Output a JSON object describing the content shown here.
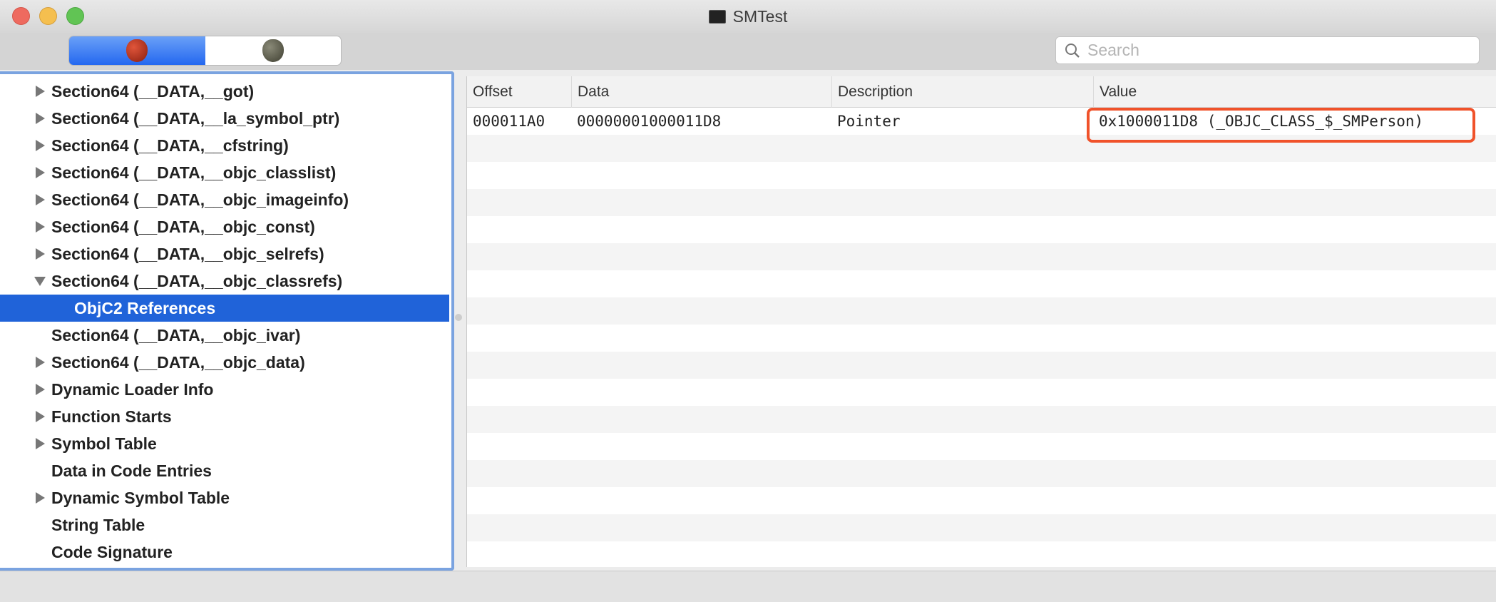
{
  "window": {
    "title": "SMTest"
  },
  "toolbar": {
    "segments": [
      {
        "icon": "apple-red-icon",
        "selected": true
      },
      {
        "icon": "apple-gray-icon",
        "selected": false
      }
    ],
    "search_placeholder": "Search"
  },
  "sidebar": {
    "items": [
      {
        "label": "Section64 (__DATA,__got)",
        "arrow": "right"
      },
      {
        "label": "Section64 (__DATA,__la_symbol_ptr)",
        "arrow": "right"
      },
      {
        "label": "Section64 (__DATA,__cfstring)",
        "arrow": "right"
      },
      {
        "label": "Section64 (__DATA,__objc_classlist)",
        "arrow": "right"
      },
      {
        "label": "Section64 (__DATA,__objc_imageinfo)",
        "arrow": "right"
      },
      {
        "label": "Section64 (__DATA,__objc_const)",
        "arrow": "right"
      },
      {
        "label": "Section64 (__DATA,__objc_selrefs)",
        "arrow": "right"
      },
      {
        "label": "Section64 (__DATA,__objc_classrefs)",
        "arrow": "down"
      },
      {
        "label": "ObjC2 References",
        "arrow": "none",
        "child": true,
        "selected": true
      },
      {
        "label": "Section64 (__DATA,__objc_ivar)",
        "arrow": "none"
      },
      {
        "label": "Section64 (__DATA,__objc_data)",
        "arrow": "right"
      },
      {
        "label": "Dynamic Loader Info",
        "arrow": "right"
      },
      {
        "label": "Function Starts",
        "arrow": "right"
      },
      {
        "label": "Symbol Table",
        "arrow": "right"
      },
      {
        "label": "Data in Code Entries",
        "arrow": "none"
      },
      {
        "label": "Dynamic Symbol Table",
        "arrow": "right"
      },
      {
        "label": "String Table",
        "arrow": "none"
      },
      {
        "label": "Code Signature",
        "arrow": "none"
      }
    ]
  },
  "table": {
    "columns": [
      "Offset",
      "Data",
      "Description",
      "Value"
    ],
    "rows": [
      [
        "000011A0",
        "00000001000011D8",
        "Pointer",
        "0x1000011D8 (_OBJC_CLASS_$_SMPerson)"
      ]
    ],
    "highlight_color": "#f0522a"
  },
  "colors": {
    "selection": "#2063d9",
    "focus_ring": "#7aa3e0"
  }
}
